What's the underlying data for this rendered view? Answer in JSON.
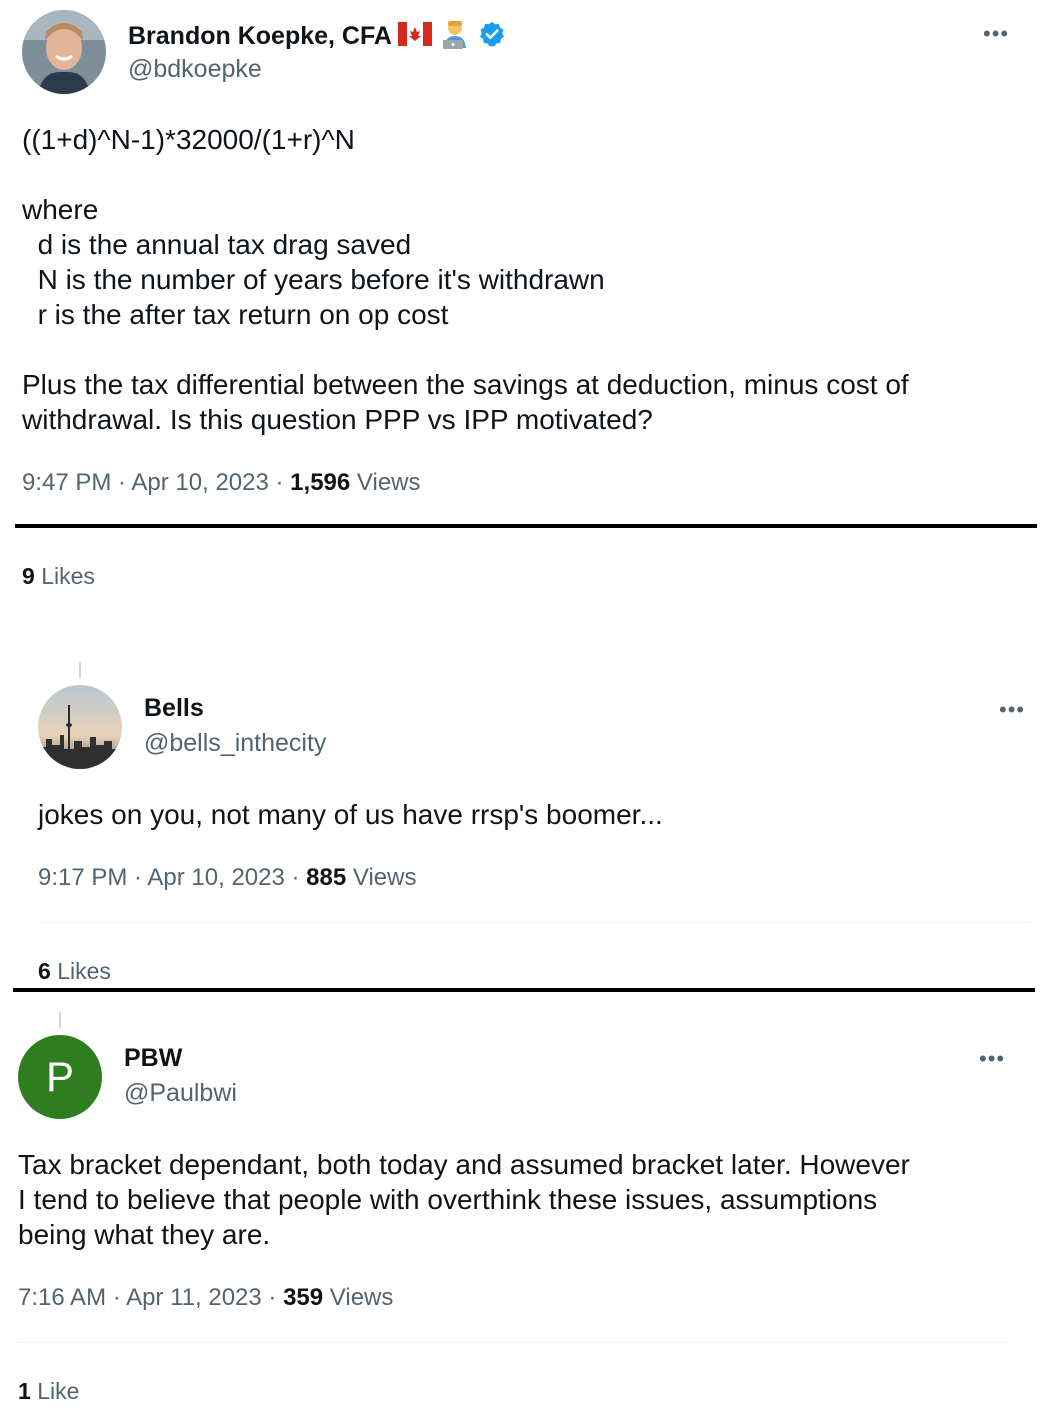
{
  "tweets": [
    {
      "author_name": "Brandon Koepke, CFA",
      "handle": "@bdkoepke",
      "emoji": [
        "canada-flag-icon",
        "technologist-icon"
      ],
      "verified": true,
      "body": "((1+d)^N-1)*32000/(1+r)^N\n\nwhere\n  d is the annual tax drag saved\n  N is the number of years before it's withdrawn\n  r is the after tax return on op cost\n\nPlus the tax differential between the savings at deduction, minus cost of\nwithdrawal. Is this question PPP vs IPP motivated?",
      "time": "9:47 PM",
      "date": "Apr 10, 2023",
      "views_count": "1,596",
      "views_label": "Views",
      "likes_count": "9",
      "likes_label": "Likes"
    },
    {
      "author_name": "Bells",
      "handle": "@bells_inthecity",
      "body": "jokes on you, not many of us have rrsp's boomer...",
      "time": "9:17 PM",
      "date": "Apr 10, 2023",
      "views_count": "885",
      "views_label": "Views",
      "likes_count": "6",
      "likes_label": "Likes"
    },
    {
      "author_name": "PBW",
      "handle": "@Paulbwi",
      "avatar_letter": "P",
      "avatar_color": "#2e7d1f",
      "body": "Tax bracket dependant, both today and assumed bracket later. However\nI tend to believe that people with overthink these issues, assumptions\nbeing what they are.",
      "time": "7:16 AM",
      "date": "Apr 11, 2023",
      "views_count": "359",
      "views_label": "Views",
      "likes_count": "1",
      "likes_label": "Like"
    }
  ],
  "separator": " · ",
  "more_glyph": "•••",
  "colors": {
    "verified": "#1d9bf0",
    "secondary_text": "#536471",
    "primary_text": "#0f1419"
  }
}
